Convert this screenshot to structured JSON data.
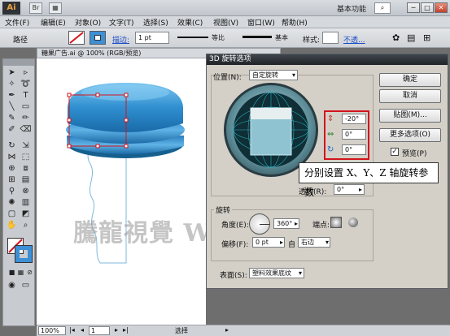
{
  "app": {
    "logo": "Ai",
    "workspace": "基本功能",
    "search_placeholder": "",
    "window_buttons": [
      "─",
      "□",
      "✕"
    ]
  },
  "menu": [
    "文件(F)",
    "编辑(E)",
    "对象(O)",
    "文字(T)",
    "选择(S)",
    "效果(C)",
    "视图(V)",
    "窗口(W)",
    "帮助(H)"
  ],
  "control": {
    "object_type": "路径",
    "stroke_label": "描边:",
    "stroke_weight": "1 pt",
    "profile_label": "等比",
    "brush_label": "基本",
    "style_label": "样式:",
    "opacity_link": "不透..."
  },
  "document": {
    "tab_title": "糖果广告.ai @ 100% (RGB/预览)",
    "zoom": "100%",
    "page": "1",
    "status_tool": "选择"
  },
  "dialog": {
    "title": "3D 旋转选项",
    "position_label": "位置(N):",
    "position_value": "自定旋转",
    "x_angle": "-20°",
    "y_angle": "0°",
    "z_angle": "0°",
    "perspective_label": "透视(R):",
    "perspective_value": "0°",
    "rotate_section": "旋转",
    "angle_label": "角度(E):",
    "angle_value": "360°",
    "cap_label": "端点:",
    "offset_label": "偏移(F):",
    "offset_value": "0 pt",
    "offset_from_label": "自",
    "offset_from_value": "右边",
    "surface_label": "表面(S):",
    "surface_value": "塑料效果底纹",
    "btn_ok": "确定",
    "btn_cancel": "取消",
    "btn_map": "贴图(M)...",
    "btn_more": "更多选项(O)",
    "preview_label": "预览(P)"
  },
  "annotation": {
    "callout": "分别设置 X、Y、Z 轴旋转参数",
    "watermark": "騰龍視覺 WWW.TLVI.NET"
  },
  "colors": {
    "object_blue": "#2f8fd0",
    "highlight_red": "#d2141c",
    "dialog_bg": "#d4d0c8"
  }
}
